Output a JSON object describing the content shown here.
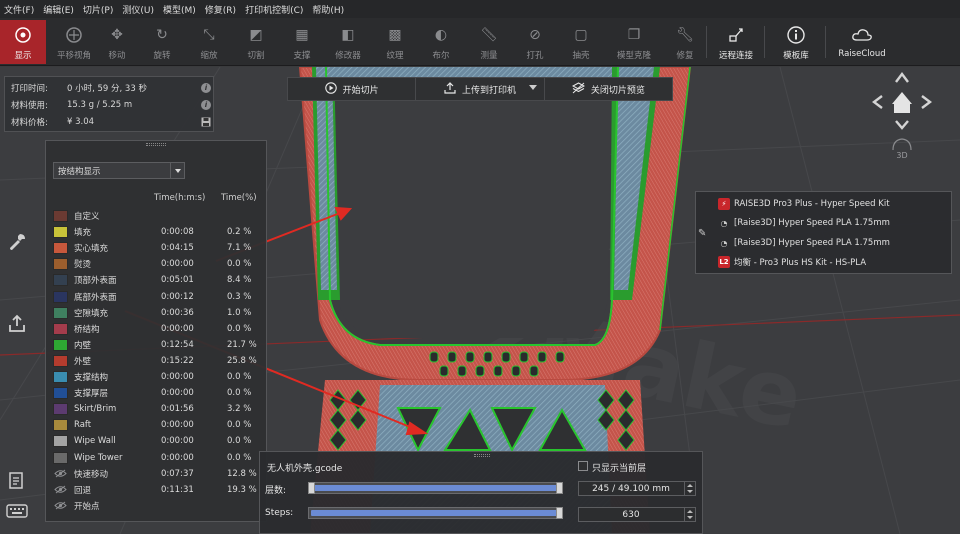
{
  "menu": [
    "文件(F)",
    "编辑(E)",
    "切片(P)",
    "测仪(U)",
    "模型(M)",
    "修复(R)",
    "打印机控制(C)",
    "帮助(H)"
  ],
  "toolbar": {
    "display": "显示",
    "pan_view": "平移视角",
    "move": "移动",
    "rotate": "旋转",
    "scale": "缩放",
    "cut": "切割",
    "support": "支撑",
    "modifier": "修改器",
    "texture": "纹理",
    "boolean": "布尔",
    "measure": "测量",
    "drill": "打孔",
    "shell": "抽壳",
    "model_cloning": "模型克隆",
    "repair": "修复",
    "remote_connect": "远程连接",
    "model_library": "模板库",
    "raisecloud": "RaiseCloud"
  },
  "info": {
    "print_time_label": "打印时间:",
    "print_time_value": "0 小时, 59 分, 33 秒",
    "material_use_label": "材料使用:",
    "material_use_value": "15.3 g / 5.25 m",
    "material_cost_label": "材料价格:",
    "material_cost_value": "¥ 3.04"
  },
  "slice_bar": {
    "start_slice": "开始切片",
    "upload": "上传到打印机",
    "close_preview": "关闭切片预览"
  },
  "structure": {
    "select_value": "按结构显示",
    "col_time": "Time(h:m:s)",
    "col_pct": "Time(%)",
    "items": [
      {
        "name": "自定义",
        "time": "",
        "pct": "",
        "color": "#6b3a32"
      },
      {
        "name": "填充",
        "time": "0:00:08",
        "pct": "0.2 %",
        "color": "#c9c339"
      },
      {
        "name": "实心填充",
        "time": "0:04:15",
        "pct": "7.1 %",
        "color": "#c8583c"
      },
      {
        "name": "熨烫",
        "time": "0:00:00",
        "pct": "0.0 %",
        "color": "#9c5e2d"
      },
      {
        "name": "顶部外表面",
        "time": "0:05:01",
        "pct": "8.4 %",
        "color": "#334050"
      },
      {
        "name": "底部外表面",
        "time": "0:00:12",
        "pct": "0.3 %",
        "color": "#2a3560"
      },
      {
        "name": "空隙填充",
        "time": "0:00:36",
        "pct": "1.0 %",
        "color": "#3f8060"
      },
      {
        "name": "桥结构",
        "time": "0:00:00",
        "pct": "0.0 %",
        "color": "#a43c4c"
      },
      {
        "name": "内壁",
        "time": "0:12:54",
        "pct": "21.7 %",
        "color": "#2ea833"
      },
      {
        "name": "外壁",
        "time": "0:15:22",
        "pct": "25.8 %",
        "color": "#b43c2e"
      },
      {
        "name": "支撑结构",
        "time": "0:00:00",
        "pct": "0.0 %",
        "color": "#3a8db0"
      },
      {
        "name": "支撑厚层",
        "time": "0:00:00",
        "pct": "0.0 %",
        "color": "#214f96"
      },
      {
        "name": "Skirt/Brim",
        "time": "0:01:56",
        "pct": "3.2 %",
        "color": "#5c3b70"
      },
      {
        "name": "Raft",
        "time": "0:00:00",
        "pct": "0.0 %",
        "color": "#a88a3c"
      },
      {
        "name": "Wipe Wall",
        "time": "0:00:00",
        "pct": "0.0 %",
        "color": "#a3a3a3"
      },
      {
        "name": "Wipe Tower",
        "time": "0:00:00",
        "pct": "0.0 %",
        "color": "#6a6a6a"
      }
    ],
    "eye_items": [
      {
        "name": "快速移动",
        "time": "0:07:37",
        "pct": "12.8 %"
      },
      {
        "name": "回退",
        "time": "0:11:31",
        "pct": "19.3 %"
      },
      {
        "name": "开始点",
        "time": "",
        "pct": ""
      }
    ]
  },
  "printer": {
    "machine": "RAISE3D Pro3 Plus - Hyper Speed Kit",
    "filament_left": "[Raise3D] Hyper Speed PLA 1.75mm",
    "filament_right": "[Raise3D] Hyper Speed PLA 1.75mm",
    "profile_badge": "L2",
    "profile": "均衡 - Pro3 Plus HS Kit - HS-PLA"
  },
  "nav": {
    "badge_3d": "3D"
  },
  "layer_panel": {
    "file_name": "无人机外壳.gcode",
    "only_current_layer": "只显示当前层",
    "layer_label": "层数:",
    "layer_value": "245 / 49.100 mm",
    "steps_label": "Steps:",
    "steps_value": "630",
    "layer_fill": 1.0,
    "steps_fill": 1.0
  },
  "colors": {
    "accent": "#a8252a",
    "outer_wall": "#c4544a",
    "top_skin": "#5a7f99",
    "inner_wall": "#29c42e"
  }
}
